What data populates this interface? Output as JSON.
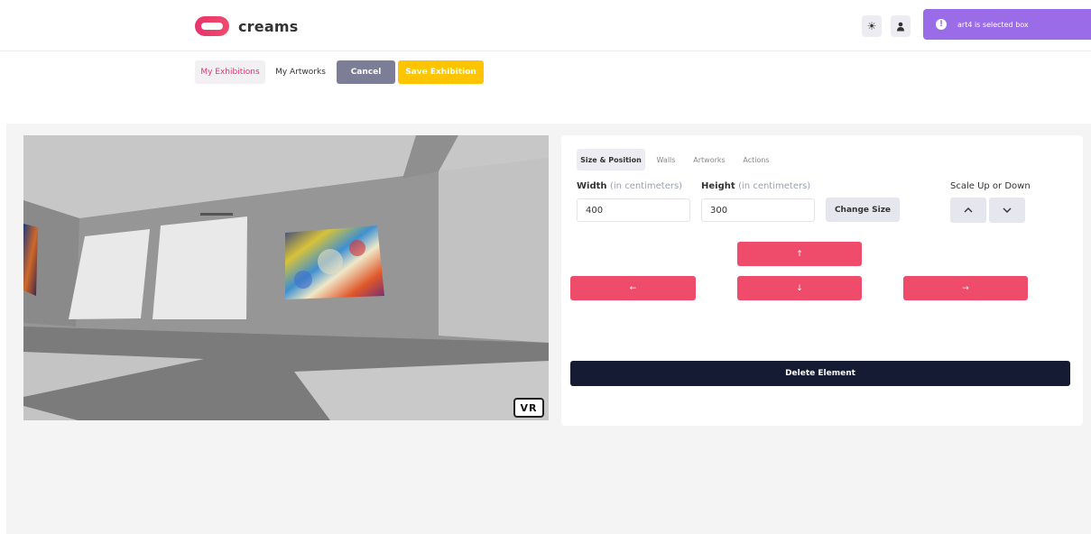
{
  "header": {
    "logo_text": "creams",
    "theme_icon": "sun-icon",
    "user_icon": "user-icon",
    "toast_message": "art4 is selected box",
    "toast_icon": "info-icon"
  },
  "nav": {
    "my_exhibitions": "My Exhibitions",
    "my_artworks": "My Artworks",
    "cancel": "Cancel",
    "save_exhibition": "Save Exhibition"
  },
  "viewport": {
    "vr_label": "VR"
  },
  "panel": {
    "tabs": [
      "Size & Position",
      "Walls",
      "Artworks",
      "Actions"
    ],
    "width_label": "Width",
    "width_hint": "(in centimeters)",
    "width_value": "400",
    "height_label": "Height",
    "height_hint": "(in centimeters)",
    "height_value": "300",
    "change_size": "Change Size",
    "scale_label": "Scale Up or Down",
    "scale_up_icon": "chevron-up-icon",
    "scale_down_icon": "chevron-down-icon",
    "arrow_up": "↑",
    "arrow_left": "←",
    "arrow_down": "↓",
    "arrow_right": "→",
    "delete_element": "Delete Element"
  },
  "colors": {
    "accent_pink": "#ef4b6b",
    "save_yellow": "#ffc400",
    "cancel_gray": "#7b7e96",
    "toast_purple": "#9b6ce8",
    "delete_dark": "#151b32"
  }
}
